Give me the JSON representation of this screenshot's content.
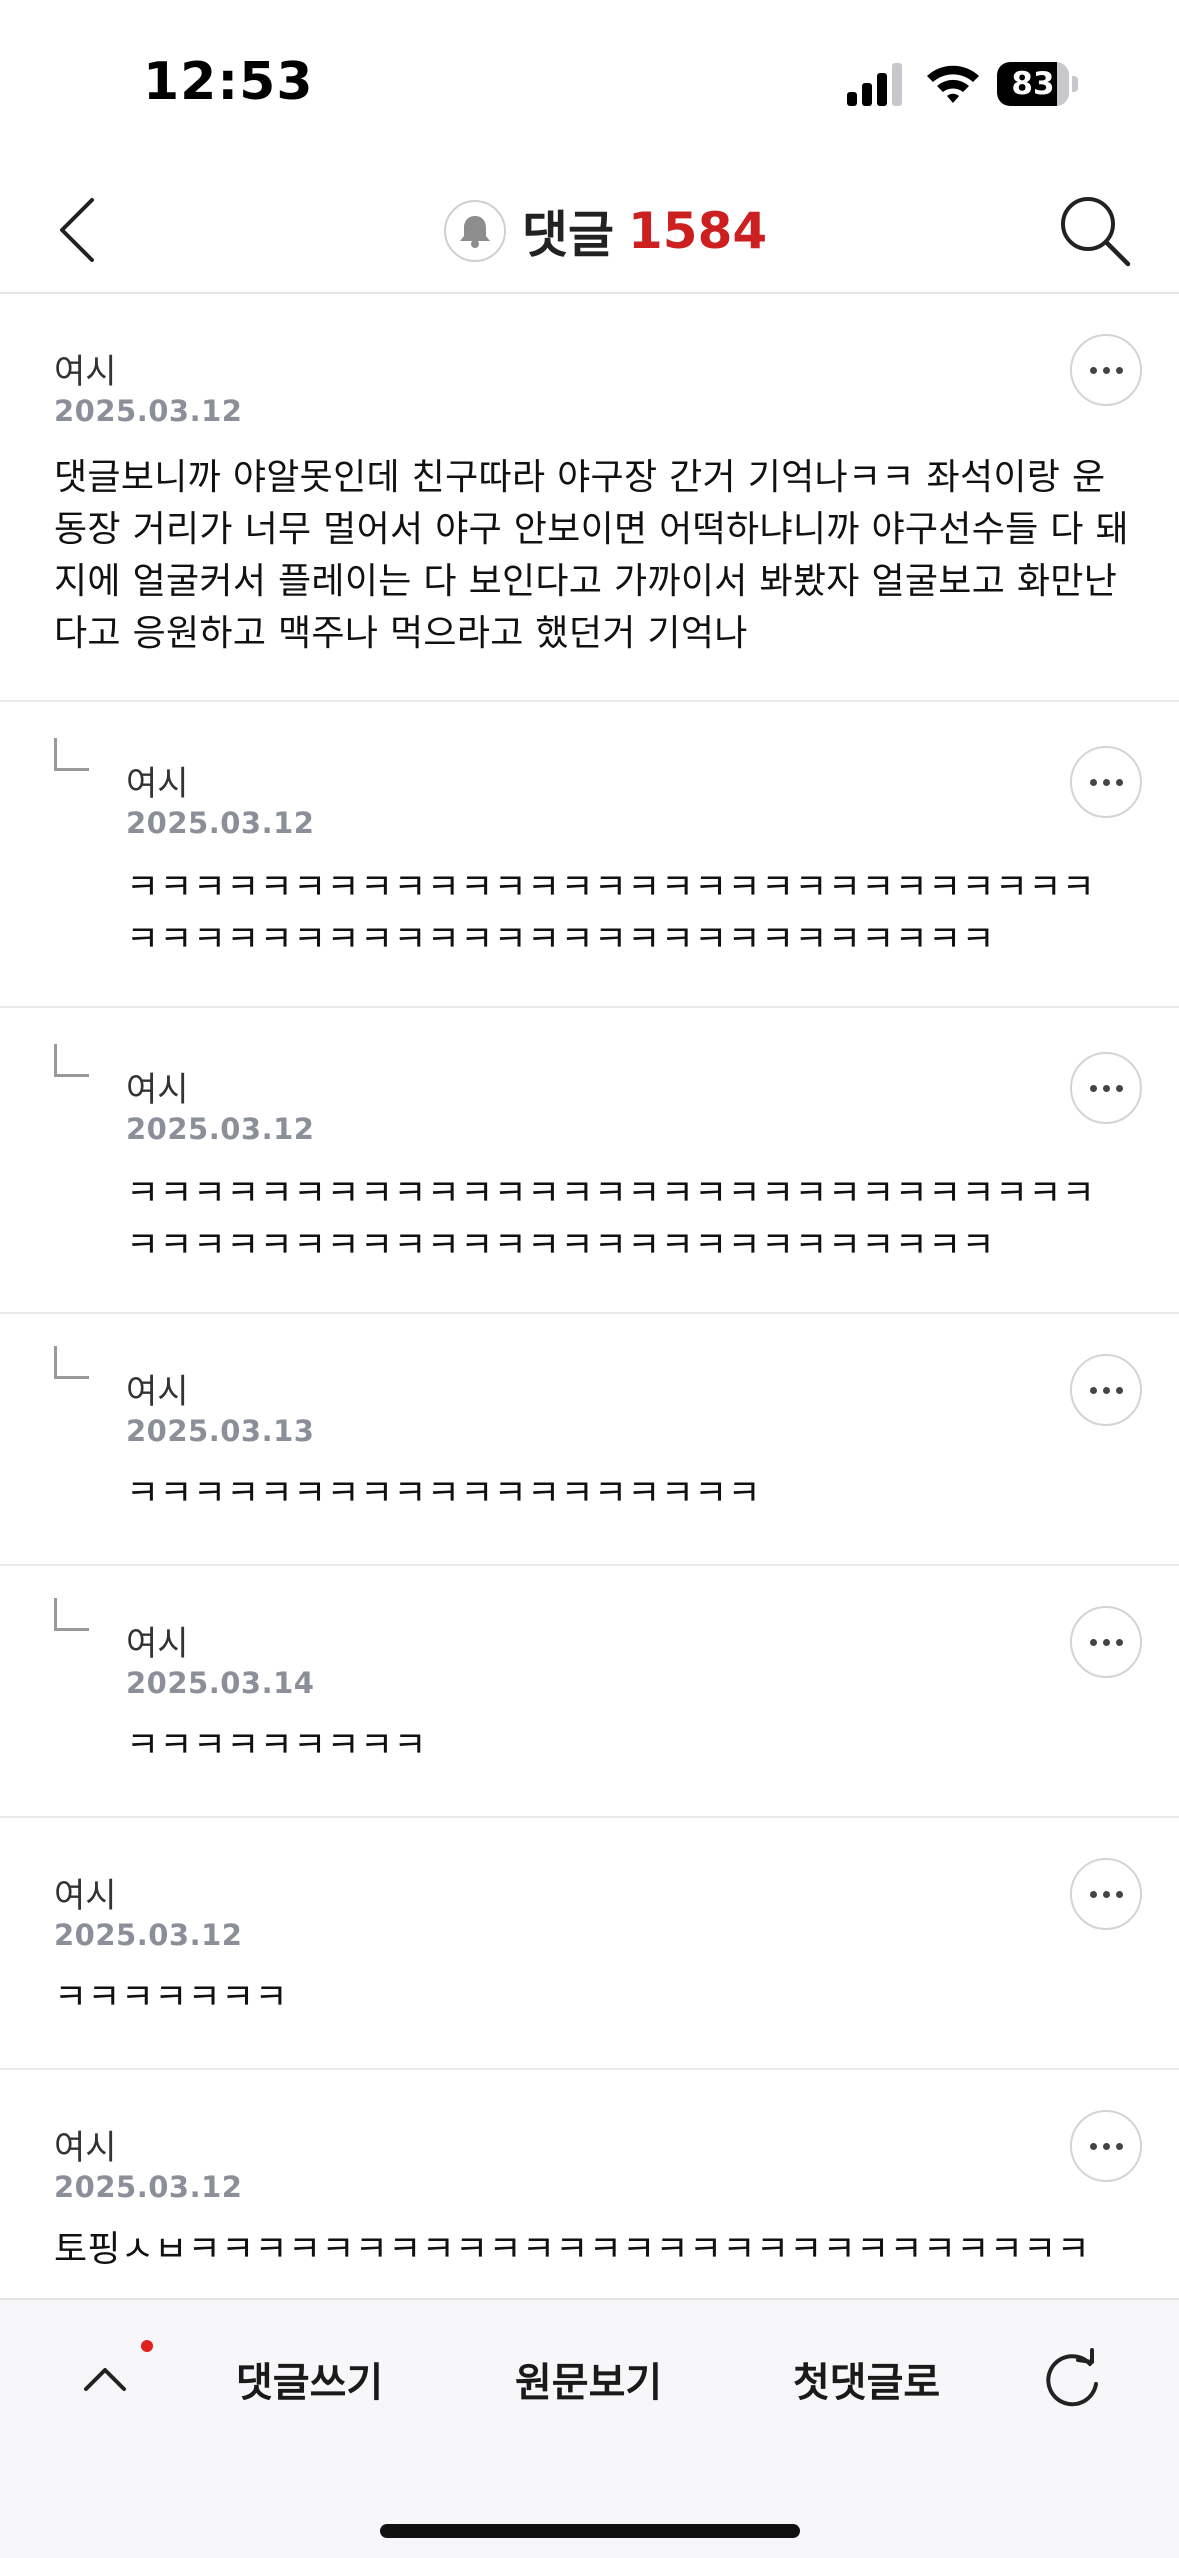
{
  "status_bar": {
    "time": "12:53",
    "battery": "83",
    "battery_level": 0.83
  },
  "header": {
    "back_icon": "chevron-left-icon",
    "bell_icon": "bell-icon",
    "title": "댓글",
    "count": "1584",
    "search_icon": "search-icon",
    "count_color": "#cc1f1f"
  },
  "comments": [
    {
      "author": "여시",
      "date": "2025.03.12",
      "reply": false,
      "text": "댓글보니까 야알못인데 친구따라 야구장 간거 기억나ㅋㅋ 좌석이랑 운동장 거리가 너무 멀어서 야구 안보이면 어떡하냐니까 야구선수들 다 돼지에 얼굴커서 플레이는 다 보인다고 가까이서 봐봤자 얼굴보고 화만난다고 응원하고 맥주나 먹으라고 했던거 기억나"
    },
    {
      "author": "여시",
      "date": "2025.03.12",
      "reply": true,
      "text": "ㅋㅋㅋㅋㅋㅋㅋㅋㅋㅋㅋㅋㅋㅋㅋㅋㅋㅋㅋㅋㅋㅋㅋㅋㅋㅋㅋㅋㅋㅋㅋㅋㅋㅋㅋㅋㅋㅋㅋㅋㅋㅋㅋㅋㅋㅋㅋㅋㅋㅋㅋㅋㅋㅋㅋ"
    },
    {
      "author": "여시",
      "date": "2025.03.12",
      "reply": true,
      "text": "ㅋㅋㅋㅋㅋㅋㅋㅋㅋㅋㅋㅋㅋㅋㅋㅋㅋㅋㅋㅋㅋㅋㅋㅋㅋㅋㅋㅋㅋㅋㅋㅋㅋㅋㅋㅋㅋㅋㅋㅋㅋㅋㅋㅋㅋㅋㅋㅋㅋㅋㅋㅋㅋㅋㅋ"
    },
    {
      "author": "여시",
      "date": "2025.03.13",
      "reply": true,
      "text": "ㅋㅋㅋㅋㅋㅋㅋㅋㅋㅋㅋㅋㅋㅋㅋㅋㅋㅋㅋ"
    },
    {
      "author": "여시",
      "date": "2025.03.14",
      "reply": true,
      "text": "ㅋㅋㅋㅋㅋㅋㅋㅋㅋ"
    },
    {
      "author": "여시",
      "date": "2025.03.12",
      "reply": false,
      "text": "ㅋㅋㅋㅋㅋㅋㅋ"
    },
    {
      "author": "여시",
      "date": "2025.03.12",
      "reply": false,
      "text": "토핑ㅅㅂㅋㅋㅋㅋㅋㅋㅋㅋㅋㅋㅋㅋㅋㅋㅋㅋㅋㅋㅋㅋㅋㅋㅋㅋㅋㅋㅋ"
    }
  ],
  "bottom_bar": {
    "scroll_top_icon": "chevron-up-icon",
    "write_comment": "댓글쓰기",
    "view_original": "원문보기",
    "first_comment": "첫댓글로",
    "refresh_icon": "refresh-icon"
  }
}
